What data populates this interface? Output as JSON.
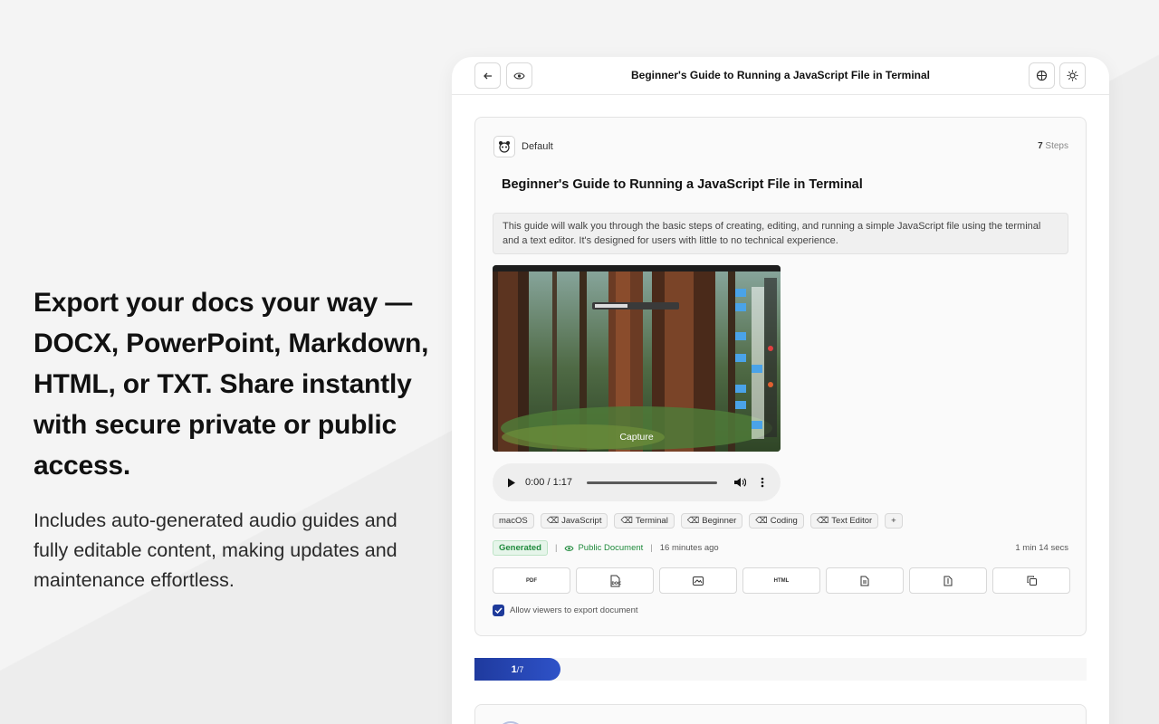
{
  "hero": {
    "headline": "Export your docs your way — DOCX, PowerPoint, Markdown, HTML, or TXT. Share instantly with secure private or public access.",
    "subtext": "Includes auto-generated audio guides and fully editable content, making updates and maintenance effortless."
  },
  "topbar": {
    "title": "Beginner's Guide to Running a JavaScript File in Terminal"
  },
  "card": {
    "workspace": "Default",
    "steps_count": "7",
    "steps_label": "Steps",
    "title": "Beginner's Guide to Running a JavaScript File in Terminal",
    "description": "This guide will walk you through the basic steps of creating, editing, and running a simple JavaScript file using the terminal and a text editor. It's designed for users with little to no technical experience.",
    "capture_label": "Capture",
    "audio_time": "0:00 / 1:17",
    "tags": [
      "macOS",
      "JavaScript",
      "Terminal",
      "Beginner",
      "Coding",
      "Text Editor"
    ],
    "add_tag": "+",
    "status_badge": "Generated",
    "visibility": "Public Document",
    "updated": "16 minutes ago",
    "duration": "1 min 14 secs",
    "export_buttons": [
      "PDF",
      "DOCX",
      "PPTX",
      "HTML",
      "TXT",
      "MD",
      "Copy"
    ],
    "export_pdf_label": "PDF",
    "export_html_label": "HTML",
    "allow_export_label": "Allow viewers to export document"
  },
  "progress": {
    "current": "1",
    "total": "7"
  },
  "colors": {
    "accent": "#1f3a9e",
    "green": "#1f8a3c"
  }
}
